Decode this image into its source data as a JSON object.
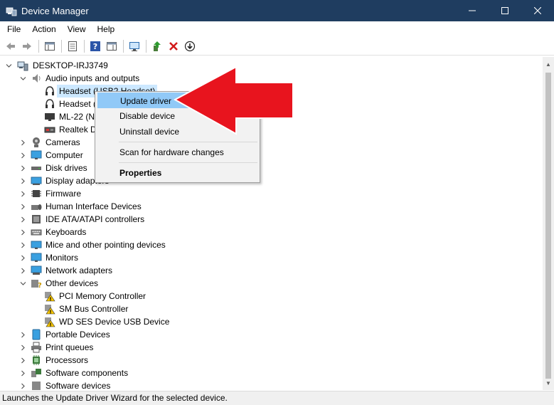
{
  "window": {
    "title": "Device Manager",
    "controls": [
      "minimize",
      "maximize",
      "close"
    ]
  },
  "menu": [
    "File",
    "Action",
    "View",
    "Help"
  ],
  "toolbar": {
    "buttons": [
      "back-icon",
      "forward-icon",
      "console-tree-icon",
      "properties-icon",
      "help-icon",
      "action-pane-icon",
      "monitor-icon",
      "update-driver-icon",
      "uninstall-icon",
      "download-icon"
    ]
  },
  "tree": {
    "root": "DESKTOP-IRJ3749",
    "audio": {
      "label": "Audio inputs and outputs",
      "children": [
        "Headset (USB2 Headset)",
        "Headset (",
        "ML-22 (N",
        "Realtek D"
      ]
    },
    "categories_a": [
      "Cameras",
      "Computer",
      "Disk drives",
      "Display adapters",
      "Firmware",
      "Human Interface Devices",
      "IDE ATA/ATAPI controllers",
      "Keyboards",
      "Mice and other pointing devices",
      "Monitors",
      "Network adapters"
    ],
    "other": {
      "label": "Other devices",
      "children": [
        "PCI Memory Controller",
        "SM Bus Controller",
        "WD SES Device USB Device"
      ]
    },
    "categories_b": [
      "Portable Devices",
      "Print queues",
      "Processors",
      "Software components",
      "Software devices"
    ]
  },
  "context_menu": {
    "update_driver": "Update driver",
    "disable_device": "Disable device",
    "uninstall_device": "Uninstall device",
    "scan": "Scan for hardware changes",
    "properties": "Properties"
  },
  "status": "Launches the Update Driver Wizard for the selected device.",
  "colors": {
    "titlebar": "#1f3d60",
    "menu_highlight": "#91c9f7",
    "annotation_arrow": "#e8141e"
  }
}
